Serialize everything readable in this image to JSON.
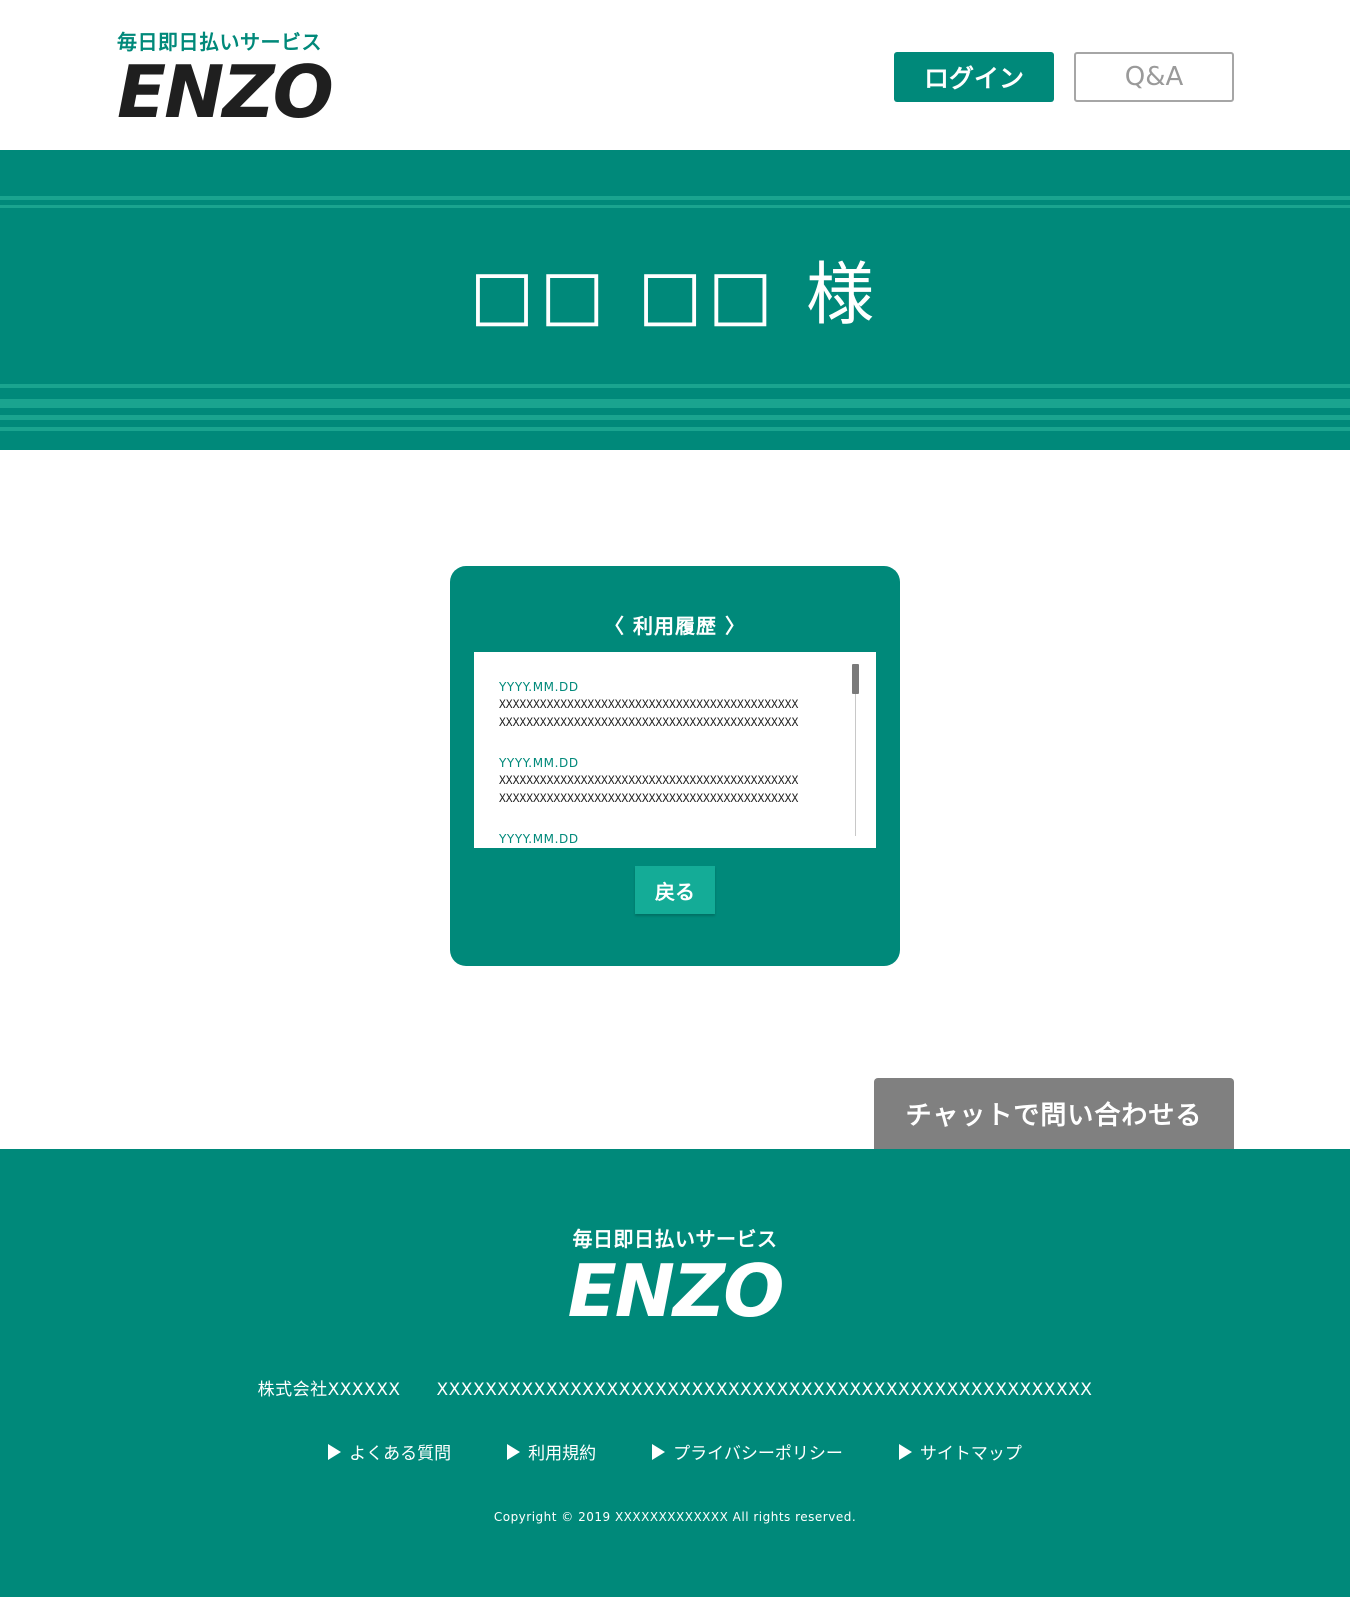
{
  "header": {
    "tagline": "毎日即日払いサービス",
    "brand": "ENZO",
    "login_label": "ログイン",
    "qa_label": "Q&A"
  },
  "hero": {
    "user_name": "□□ □□ 様"
  },
  "card": {
    "title": "〈 利用履歴 〉",
    "history": [
      {
        "date": "YYYY.MM.DD",
        "lines": [
          "XXXXXXXXXXXXXXXXXXXXXXXXXXXXXXXXXXXXXXXXXXXX",
          "XXXXXXXXXXXXXXXXXXXXXXXXXXXXXXXXXXXXXXXXXXXX"
        ]
      },
      {
        "date": "YYYY.MM.DD",
        "lines": [
          "XXXXXXXXXXXXXXXXXXXXXXXXXXXXXXXXXXXXXXXXXXXX",
          "XXXXXXXXXXXXXXXXXXXXXXXXXXXXXXXXXXXXXXXXXXXX"
        ]
      },
      {
        "date": "YYYY.MM.DD",
        "lines": []
      }
    ],
    "back_label": "戻る"
  },
  "chat": {
    "label": "チャットで問い合わせる"
  },
  "footer": {
    "tagline": "毎日即日払いサービス",
    "brand": "ENZO",
    "company": "株式会社XXXXXX",
    "address": "XXXXXXXXXXXXXXXXXXXXXXXXXXXXXXXXXXXXXXXXXXXXXXXXXXXXXX",
    "links": [
      "よくある質問",
      "利用規約",
      "プライバシーポリシー",
      "サイトマップ"
    ],
    "copyright": "Copyright © 2019 XXXXXXXXXXXXX All rights reserved."
  },
  "colors": {
    "brand": "#00897a",
    "stripe": "#1aa48f",
    "back_button": "#14ac97",
    "chat_button": "#808080"
  }
}
